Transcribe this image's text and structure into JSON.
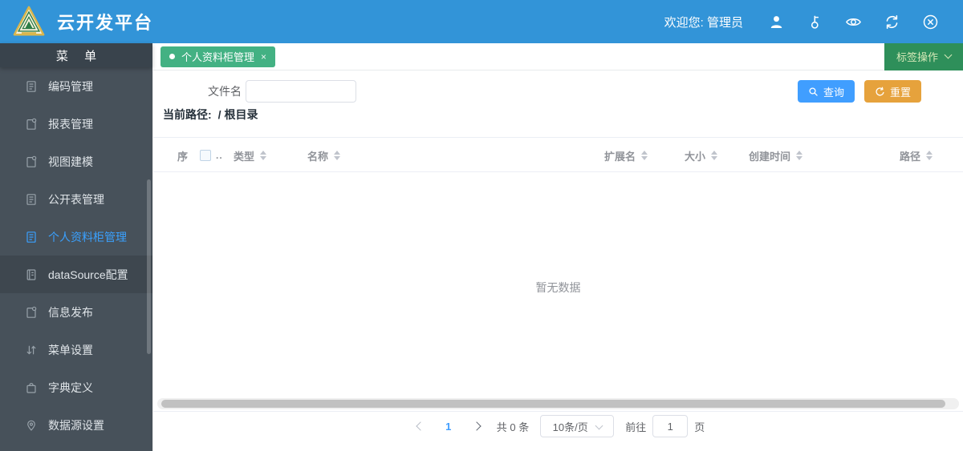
{
  "header": {
    "title": "云开发平台",
    "welcome_label": "欢迎您:",
    "username": "管理员"
  },
  "sidebar": {
    "title": "菜 单",
    "items": [
      {
        "label": "编码管理",
        "icon": "document-icon",
        "active": false
      },
      {
        "label": "报表管理",
        "icon": "file-badge-icon",
        "active": false
      },
      {
        "label": "视图建模",
        "icon": "file-badge-icon",
        "active": false
      },
      {
        "label": "公开表管理",
        "icon": "document-icon",
        "active": false
      },
      {
        "label": "个人资料柜管理",
        "icon": "document-icon",
        "active": true
      },
      {
        "label": "dataSource配置",
        "icon": "notebook-icon",
        "active": false
      },
      {
        "label": "信息发布",
        "icon": "file-badge-icon",
        "active": false
      },
      {
        "label": "菜单设置",
        "icon": "sort-arrows-icon",
        "active": false
      },
      {
        "label": "字典定义",
        "icon": "briefcase-icon",
        "active": false
      },
      {
        "label": "数据源设置",
        "icon": "location-pin-icon",
        "active": false
      }
    ]
  },
  "tabbar": {
    "tab": {
      "label": "个人资料柜管理",
      "close": "×"
    },
    "actions_label": "标签操作"
  },
  "toolbar": {
    "filename_label": "文件名",
    "filename_value": "",
    "search_label": "查询",
    "reset_label": "重置"
  },
  "path": {
    "label": "当前路径:",
    "value": "/ 根目录"
  },
  "table": {
    "columns": [
      "序",
      "类型",
      "名称",
      "扩展名",
      "大小",
      "创建时间",
      "路径"
    ],
    "checkbox_suffix": "..",
    "empty_text": "暂无数据"
  },
  "pagination": {
    "current_page": "1",
    "total_label": "共 0 条",
    "page_size": "10条/页",
    "goto_label": "前往",
    "goto_value": "1",
    "page_label": "页"
  },
  "colors": {
    "header_blue": "#3294d8",
    "sidebar_bg": "#47515a",
    "sidebar_title_bg": "#39434c",
    "active_item": "#3aa1ff",
    "tab_green": "#43b183",
    "actions_green": "#2e8f5a",
    "primary_button": "#409eff",
    "warning_button": "#e6a23c"
  }
}
